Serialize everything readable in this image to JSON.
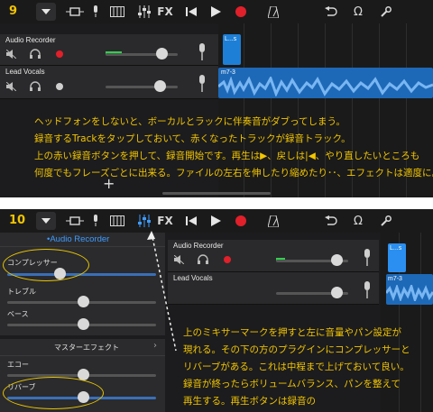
{
  "step1": {
    "number": "9",
    "tracks": [
      {
        "name": "Audio Recorder"
      },
      {
        "name": "Lead Vocals"
      }
    ],
    "regions": {
      "audio_recorder": "L...s",
      "lead_vocals": "m7-3"
    },
    "caption": [
      "ヘッドフォンをしないと、ボーカルとラックに伴奏音がダブってしまう。",
      "録音するTrackをタップしておいて、赤くなったトラックが録音トラック。",
      "上の赤い録音ボタンを押して、録音開始です。再生は▶、戻しは|◀、やり直したいところも",
      "何度でもフレーズごとに出来る。ファイルの左右を伸したり縮めたり･･、エフェクトは適度に。"
    ],
    "plus": "+"
  },
  "step2": {
    "number": "10",
    "side_title": "•Audio Recorder",
    "plugins": {
      "compressor": "コンプレッサー",
      "treble": "トレブル",
      "bass": "ベース",
      "master_effect": "マスターエフェクト",
      "echo": "エコー",
      "reverb": "リバーブ"
    },
    "tracks": [
      {
        "name": "Audio Recorder"
      },
      {
        "name": "Lead Vocals"
      }
    ],
    "regions": {
      "audio_recorder": "L...s",
      "lead_vocals": "m7-3"
    },
    "caption": [
      "上のミキサーマークを押すと左に音量やパン設定が",
      "現れる。その下の方のプラグインにコンプレッサーと",
      "リバーブがある。これは中程まで上げておいて良い。",
      "録音が終ったらボリュームバランス、パンを整えて",
      "再生する。再生ボタンは録音の"
    ]
  },
  "toolbar": {
    "fx_label": "FX"
  },
  "colors": {
    "caption": "#f2c500",
    "record": "#e0202a",
    "region": "#1e7fd6",
    "meter": "#2fd14c",
    "panel_title": "#3d9bff"
  }
}
